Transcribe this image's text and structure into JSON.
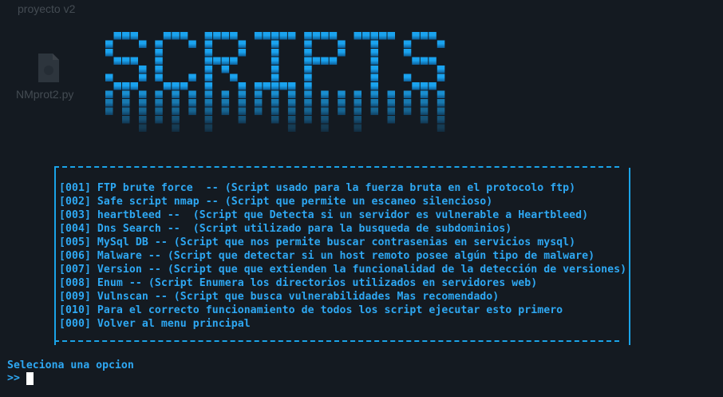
{
  "colors": {
    "background": "#141a21",
    "accent": "#2ea8f3",
    "cursor": "#ffffff"
  },
  "desktop": {
    "folder_title": "proyecto v2",
    "file_name": "NMprot2.py",
    "file_icon": "python-file-icon"
  },
  "banner": {
    "text": "SCRIPTS"
  },
  "menu": {
    "items": [
      "[001] FTP brute force  -- (Script usado para la fuerza bruta en el protocolo ftp)",
      "[002] Safe script nmap -- (Script que permite un escaneo silencioso)",
      "[003] heartbleed --  (Script que Detecta si un servidor es vulnerable a Heartbleed)",
      "[004] Dns Search --  (Script utilizado para la busqueda de subdominios)",
      "[005] MySql DB -- (Script que nos permite buscar contrasenias en servicios mysql)",
      "[006] Malware -- (Script que detectar si un host remoto posee algún tipo de malware)",
      "[007] Version -- (Script que que extienden la funcionalidad de la detección de versiones)",
      "[008] Enum -- (Script Enumera los directorios utilizados en servidores web)",
      "[009] Vulnscan -- (Script que busca vulnerabilidades Mas recomendado)",
      "[010] Para el correcto funcionamiento de todos los script ejecutar esto primero",
      "[000] Volver al menu principal"
    ]
  },
  "prompt": {
    "label": "Seleciona una opcion",
    "symbol": ">>"
  }
}
